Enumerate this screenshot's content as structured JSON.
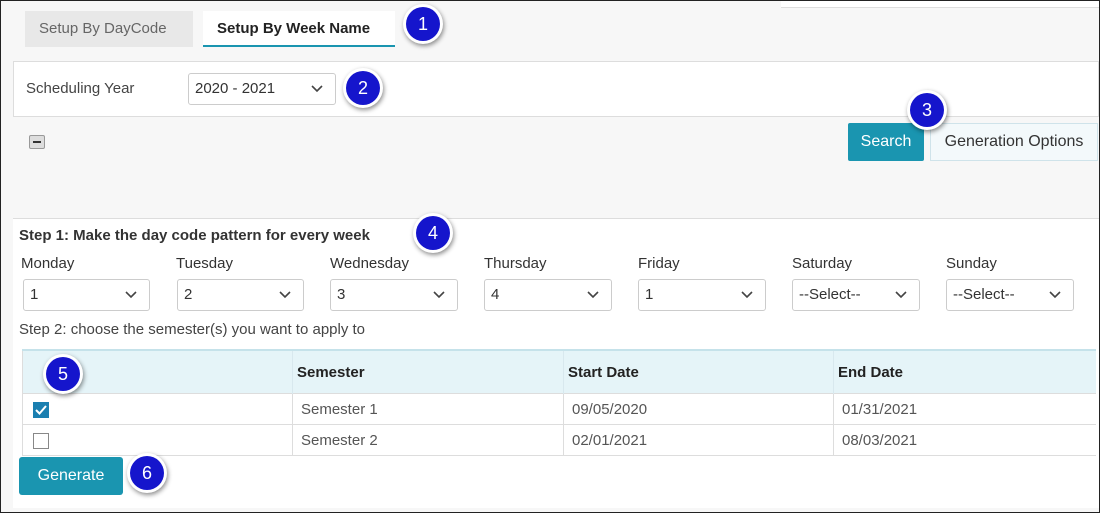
{
  "tabs": [
    {
      "label": "Setup By DayCode"
    },
    {
      "label": "Setup By Week Name"
    }
  ],
  "year": {
    "label": "Scheduling Year",
    "value": "2020 - 2021"
  },
  "toolbar": {
    "search_label": "Search",
    "generation_options_label": "Generation Options"
  },
  "step1": {
    "title": "Step 1: Make the day code pattern for every week",
    "days": [
      {
        "label": "Monday",
        "value": "1"
      },
      {
        "label": "Tuesday",
        "value": "2"
      },
      {
        "label": "Wednesday",
        "value": "3"
      },
      {
        "label": "Thursday",
        "value": "4"
      },
      {
        "label": "Friday",
        "value": "1"
      },
      {
        "label": "Saturday",
        "value": "--Select--"
      },
      {
        "label": "Sunday",
        "value": "--Select--"
      }
    ]
  },
  "step2": {
    "title": "Step 2: choose the semester(s) you want to apply to",
    "columns": [
      "",
      "Semester",
      "Start Date",
      "End Date"
    ],
    "rows": [
      {
        "checked": true,
        "semester": "Semester 1",
        "start": "09/05/2020",
        "end": "01/31/2021"
      },
      {
        "checked": false,
        "semester": "Semester 2",
        "start": "02/01/2021",
        "end": "08/03/2021"
      }
    ]
  },
  "generate_label": "Generate",
  "callouts": [
    "1",
    "2",
    "3",
    "4",
    "5",
    "6"
  ],
  "colors": {
    "accent": "#1a95b0",
    "callout": "#1515cc"
  }
}
